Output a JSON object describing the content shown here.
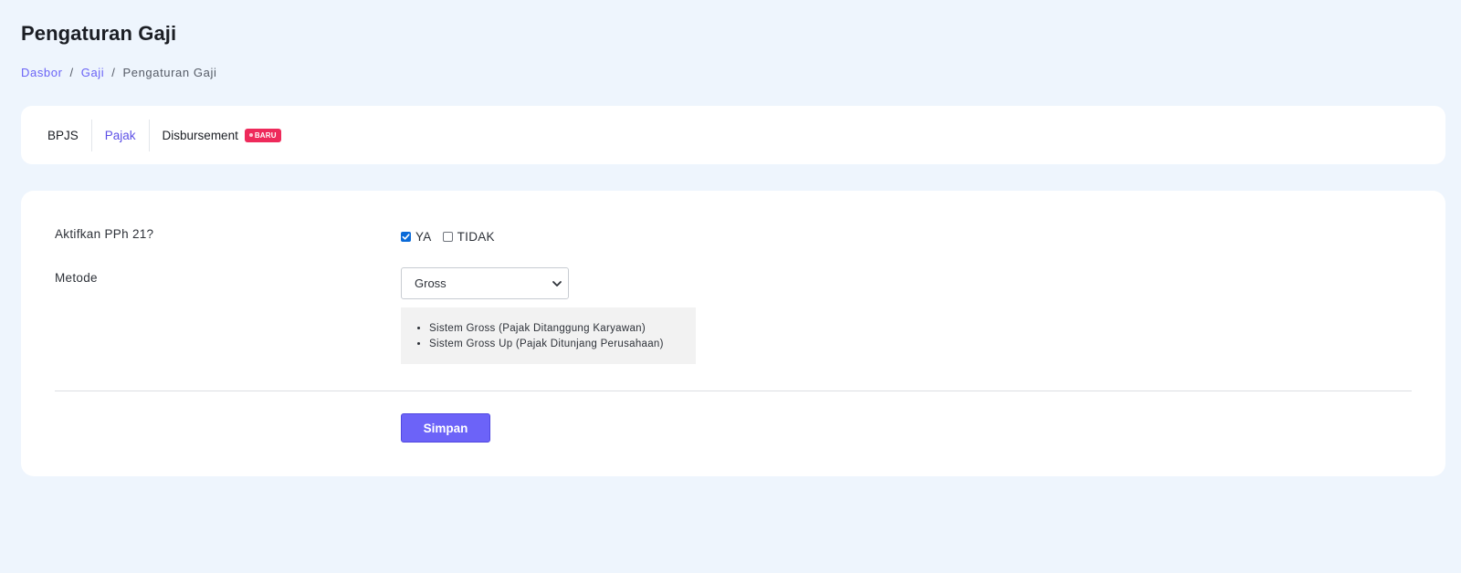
{
  "page": {
    "title": "Pengaturan Gaji"
  },
  "breadcrumb": {
    "items": [
      "Dasbor",
      "Gaji",
      "Pengaturan Gaji"
    ],
    "separator": "/"
  },
  "tabs": [
    {
      "label": "BPJS",
      "active": false
    },
    {
      "label": "Pajak",
      "active": true
    },
    {
      "label": "Disbursement",
      "active": false,
      "badge": "BARU"
    }
  ],
  "form": {
    "pph21": {
      "label": "Aktifkan PPh 21?",
      "options": [
        {
          "label": "YA",
          "checked": true
        },
        {
          "label": "TIDAK",
          "checked": false
        }
      ]
    },
    "method": {
      "label": "Metode",
      "selected": "Gross",
      "notes": [
        "Sistem Gross (Pajak Ditanggung Karyawan)",
        "Sistem Gross Up (Pajak Ditunjang Perusahaan)"
      ]
    },
    "save_label": "Simpan"
  },
  "colors": {
    "accent": "#6c63f8",
    "active_tab": "#5d50e6",
    "badge": "#ee2a5b",
    "checkbox": "#0a6ad8",
    "background": "#eef5fd"
  },
  "icons": {
    "select_chevron": "chevron-down-icon",
    "checkbox_check": "check-icon"
  }
}
